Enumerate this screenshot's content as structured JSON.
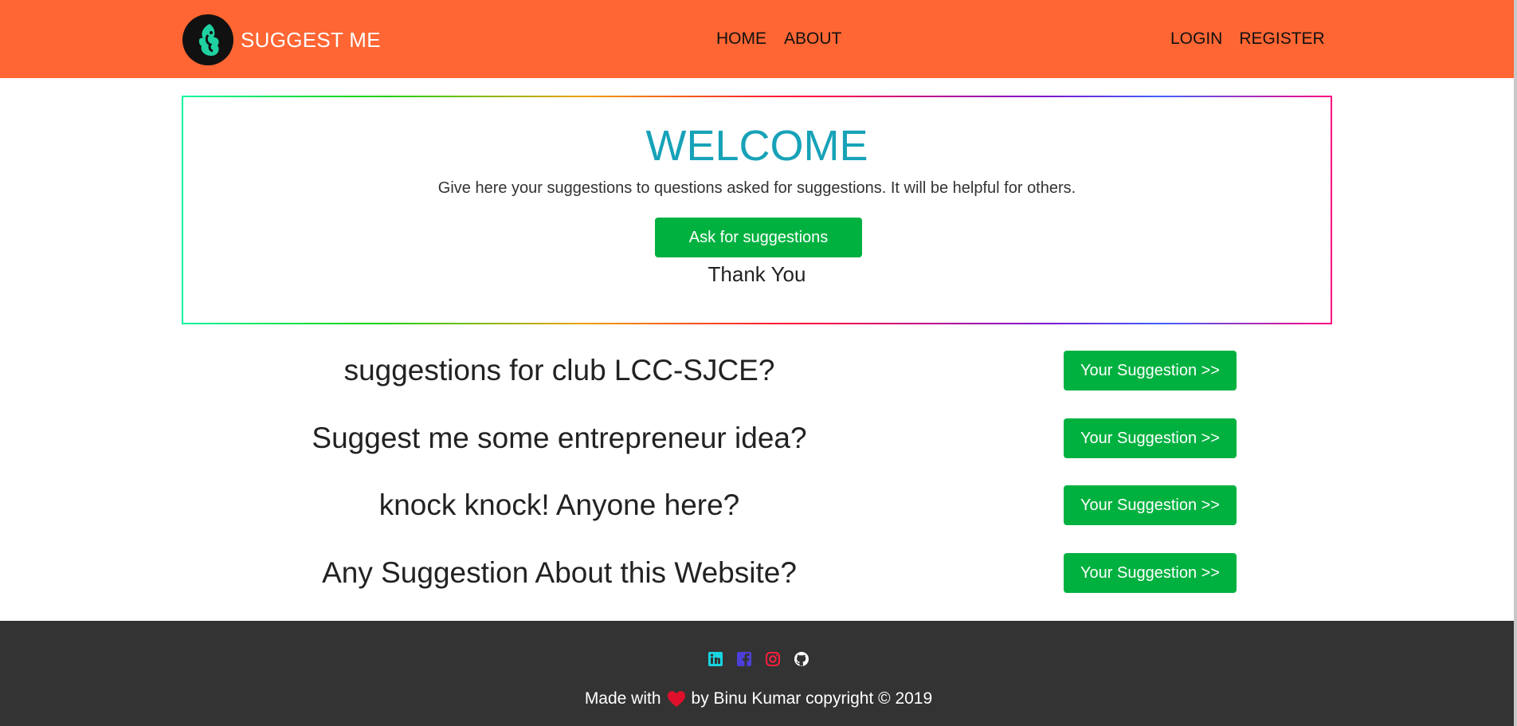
{
  "navbar": {
    "brand": "SUGGEST ME",
    "links_center": [
      "HOME",
      "ABOUT"
    ],
    "links_right": [
      "LOGIN",
      "REGISTER"
    ],
    "background": "#ff6633"
  },
  "welcome": {
    "title": "WELCOME",
    "text": "Give here your suggestions to questions asked for suggestions. It will be helpful for others.",
    "button": "Ask for suggestions",
    "thanks": "Thank You"
  },
  "questions": [
    {
      "text": "suggestions for club LCC-SJCE?",
      "button": "Your Suggestion >>"
    },
    {
      "text": "Suggest me some entrepreneur idea?",
      "button": "Your Suggestion >>"
    },
    {
      "text": "knock knock! Anyone here?",
      "button": "Your Suggestion >>"
    },
    {
      "text": "Any Suggestion About this Website?",
      "button": "Your Suggestion >>"
    }
  ],
  "footer": {
    "icons": [
      "linkedin-icon",
      "facebook-icon",
      "instagram-icon",
      "github-icon"
    ],
    "made_with": "Made with",
    "by_text": "by Binu Kumar copyright © 2019"
  },
  "colors": {
    "accent_green": "#00b140",
    "title_teal": "#17a2b8",
    "footer_bg": "#333333"
  }
}
